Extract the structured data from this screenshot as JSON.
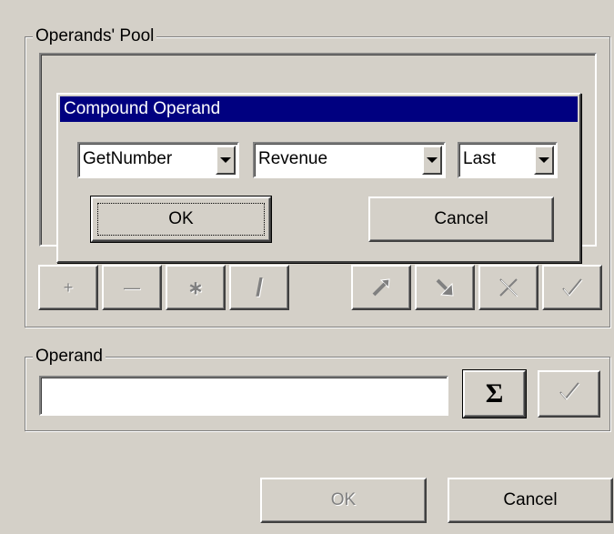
{
  "operands_pool": {
    "label": "Operands' Pool"
  },
  "compound_dialog": {
    "title": "Compound Operand",
    "function_select": {
      "value": "GetNumber"
    },
    "field_select": {
      "value": "Revenue"
    },
    "period_select": {
      "value": "Last"
    },
    "ok_label": "OK",
    "cancel_label": "Cancel"
  },
  "toolbar": {
    "icons": [
      "plus-icon",
      "minus-icon",
      "multiply-icon",
      "divide-icon",
      "arrow-up-right-icon",
      "arrow-down-right-icon",
      "delete-x-icon",
      "checkmark-icon"
    ],
    "plus": "+",
    "minus": "—",
    "multiply": "∗",
    "divide": "/"
  },
  "operand": {
    "label": "Operand",
    "value": "",
    "sigma_label": "Σ"
  },
  "footer": {
    "ok_label": "OK",
    "cancel_label": "Cancel"
  }
}
